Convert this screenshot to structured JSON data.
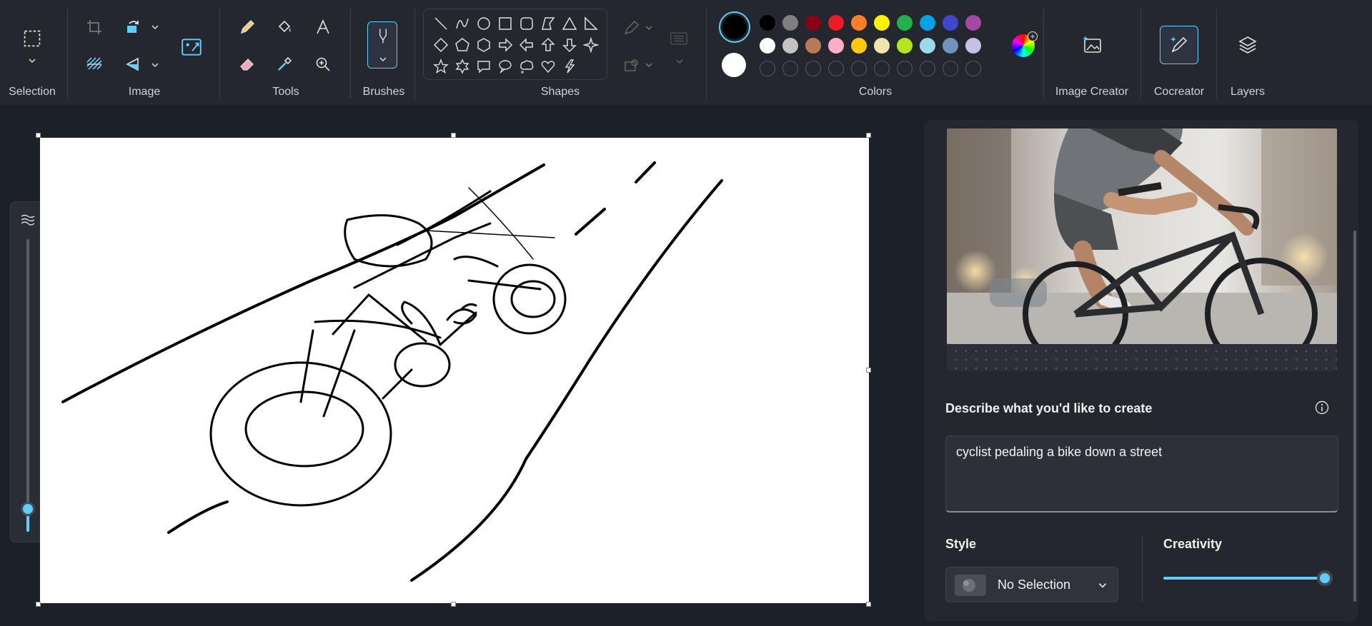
{
  "toolbar": {
    "groups": {
      "selection": "Selection",
      "image": "Image",
      "tools": "Tools",
      "brushes": "Brushes",
      "shapes": "Shapes",
      "colors": "Colors",
      "image_creator": "Image Creator",
      "cocreator": "Cocreator",
      "layers": "Layers"
    },
    "palette": {
      "primary": "#000000",
      "secondary": "#ffffff",
      "row1": [
        "#000000",
        "#7f7f7f",
        "#880015",
        "#ed1c24",
        "#ff7f27",
        "#fff200",
        "#22b14c",
        "#00a2e8",
        "#3f48cc",
        "#a349a4"
      ],
      "row2": [
        "#ffffff",
        "#c3c3c3",
        "#b97a57",
        "#ffaec9",
        "#ffc90e",
        "#efe4b0",
        "#b5e61d",
        "#99d9ea",
        "#7092be",
        "#c8bfe7"
      ],
      "empty_count": 10
    },
    "accent": "#60cdff"
  },
  "cocreator": {
    "describe_label": "Describe what you'd like to create",
    "prompt": "cyclist pedaling a bike down a street",
    "style_label": "Style",
    "style_value": "No Selection",
    "creativity_label": "Creativity",
    "creativity_level": 1.0
  }
}
